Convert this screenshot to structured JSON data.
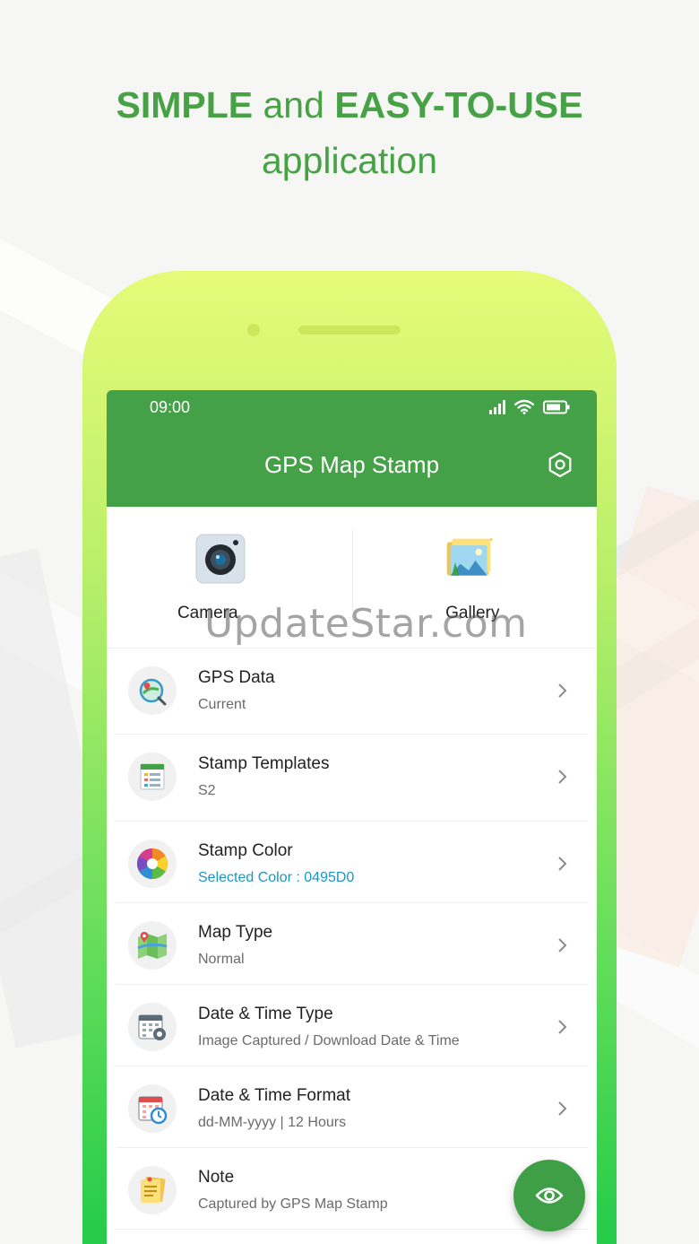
{
  "headline": {
    "line1_bold_a": "SIMPLE",
    "line1_mid": " and ",
    "line1_bold_b": "EASY-TO-USE",
    "line2": "application"
  },
  "status_bar": {
    "time": "09:00"
  },
  "app_bar": {
    "title": "GPS Map Stamp",
    "settings_icon": "gear-icon"
  },
  "quick_actions": [
    {
      "label": "Camera",
      "icon": "camera-icon"
    },
    {
      "label": "Gallery",
      "icon": "gallery-icon"
    }
  ],
  "watermark": "UpdateStar.com",
  "settings": [
    {
      "title": "GPS Data",
      "subtitle": "Current",
      "icon": "gps-data-icon"
    },
    {
      "title": "Stamp Templates",
      "subtitle": "S2",
      "icon": "template-icon"
    },
    {
      "title": "Stamp Color",
      "subtitle": "Selected Color : 0495D0",
      "icon": "color-wheel-icon",
      "accent": "#0495D0"
    },
    {
      "title": "Map Type",
      "subtitle": "Normal",
      "icon": "map-icon"
    },
    {
      "title": "Date & Time Type",
      "subtitle": "Image Captured / Download Date & Time",
      "icon": "calendar-gear-icon"
    },
    {
      "title": "Date & Time Format",
      "subtitle": "dd-MM-yyyy | 12 Hours",
      "icon": "calendar-clock-icon"
    },
    {
      "title": "Note",
      "subtitle": "Captured by GPS Map Stamp",
      "icon": "note-icon"
    }
  ],
  "fab": {
    "icon": "eye-icon"
  },
  "colors": {
    "brand_green": "#45A147",
    "headline_green": "#47A246",
    "link_blue": "#1A97C6"
  }
}
